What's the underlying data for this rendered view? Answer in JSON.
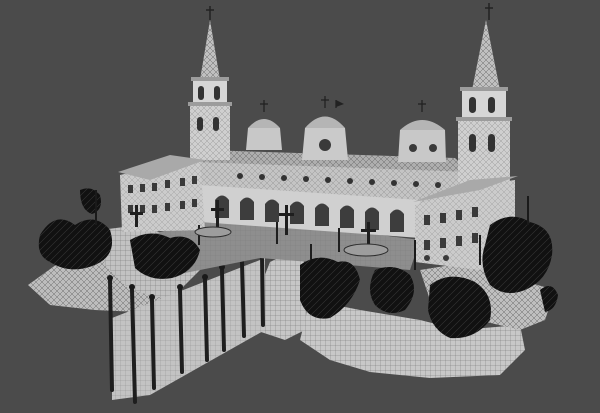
{
  "viewport": {
    "background": "#4b4b4b",
    "shading": "wireframe-on-shaded",
    "subject": "cathedral-castle-on-rock-island"
  },
  "colors": {
    "wall": "#c9c9c9",
    "wall_shadow": "#9a9a9a",
    "roof": "#b4b4b4",
    "rock": "#b9b9b9",
    "foliage": "#111111",
    "wire": "#5c5c5c",
    "window": "#3a3a3a"
  }
}
